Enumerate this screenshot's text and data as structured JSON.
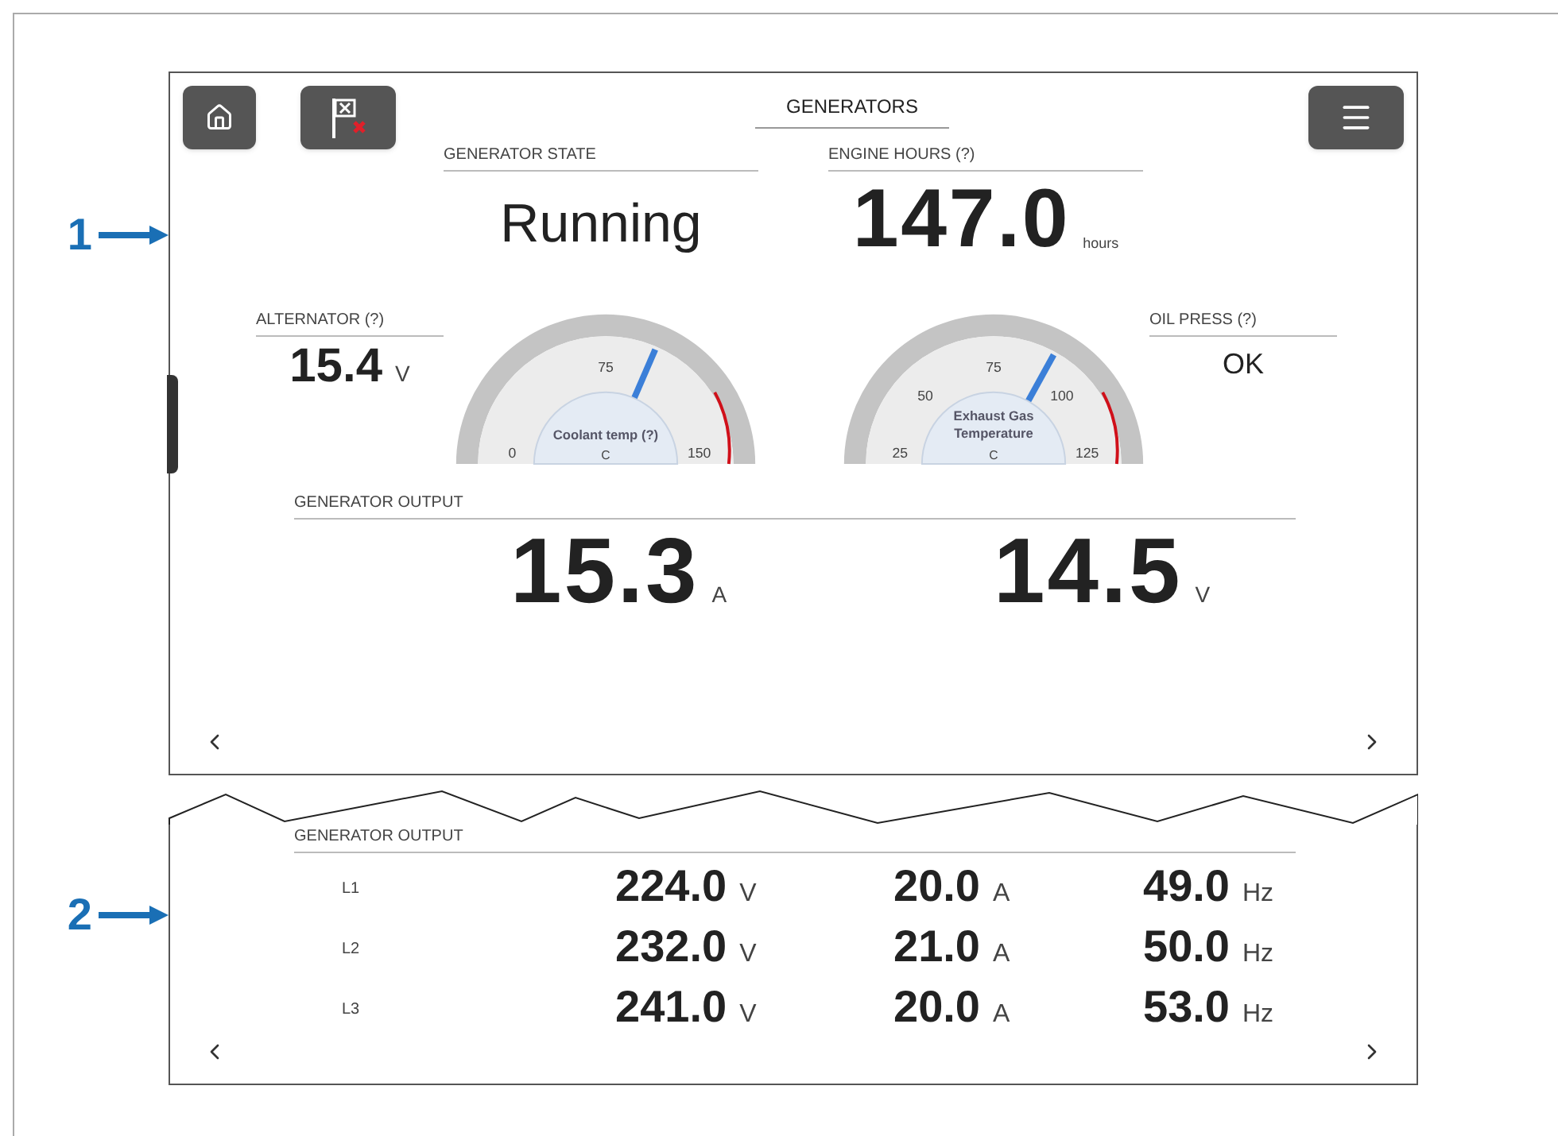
{
  "callouts": [
    {
      "label": "1"
    },
    {
      "label": "2"
    }
  ],
  "screen": {
    "title": "GENERATORS",
    "state": {
      "label": "GENERATOR STATE",
      "value": "Running"
    },
    "engine_hours": {
      "label": "ENGINE HOURS (?)",
      "value": "147.0",
      "unit": "hours"
    },
    "alternator": {
      "label": "ALTERNATOR (?)",
      "value": "15.4",
      "unit": "V"
    },
    "gauges": [
      {
        "title": "Coolant temp (?)",
        "unit": "C",
        "level": 0.63,
        "ticks": [
          "0",
          "75",
          "150"
        ]
      },
      {
        "title": "Exhaust Gas Temperature",
        "unit": "C",
        "level": 0.66,
        "ticks": [
          "25",
          "50",
          "75",
          "100",
          "125"
        ]
      }
    ],
    "oil_press": {
      "label": "OIL PRESS (?)",
      "value": "OK"
    },
    "output": {
      "label": "GENERATOR OUTPUT",
      "readings": [
        {
          "value": "15.3",
          "unit": "A"
        },
        {
          "value": "14.5",
          "unit": "V"
        }
      ]
    }
  },
  "detail": {
    "label": "GENERATOR OUTPUT",
    "rows": [
      {
        "line": "L1",
        "readings": [
          {
            "value": "224.0",
            "unit": "V"
          },
          {
            "value": "20.0",
            "unit": "A"
          },
          {
            "value": "49.0",
            "unit": "Hz"
          }
        ]
      },
      {
        "line": "L2",
        "readings": [
          {
            "value": "232.0",
            "unit": "V"
          },
          {
            "value": "21.0",
            "unit": "A"
          },
          {
            "value": "50.0",
            "unit": "Hz"
          }
        ]
      },
      {
        "line": "L3",
        "readings": [
          {
            "value": "241.0",
            "unit": "V"
          },
          {
            "value": "20.0",
            "unit": "A"
          },
          {
            "value": "53.0",
            "unit": "Hz"
          }
        ]
      }
    ]
  }
}
